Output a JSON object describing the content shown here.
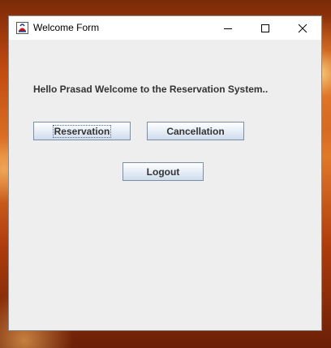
{
  "window": {
    "title": "Welcome Form",
    "controls": [
      "minimize-icon",
      "maximize-icon",
      "close-icon"
    ]
  },
  "content": {
    "welcome_message": "Hello Prasad Welcome to the Reservation System..",
    "buttons": {
      "reservation": "Reservation",
      "cancellation": "Cancellation",
      "logout": "Logout"
    }
  },
  "colors": {
    "window_bg": "#eeeeee",
    "titlebar_bg": "#ffffff",
    "button_border": "#7a8ea8",
    "label_text": "#333333"
  }
}
